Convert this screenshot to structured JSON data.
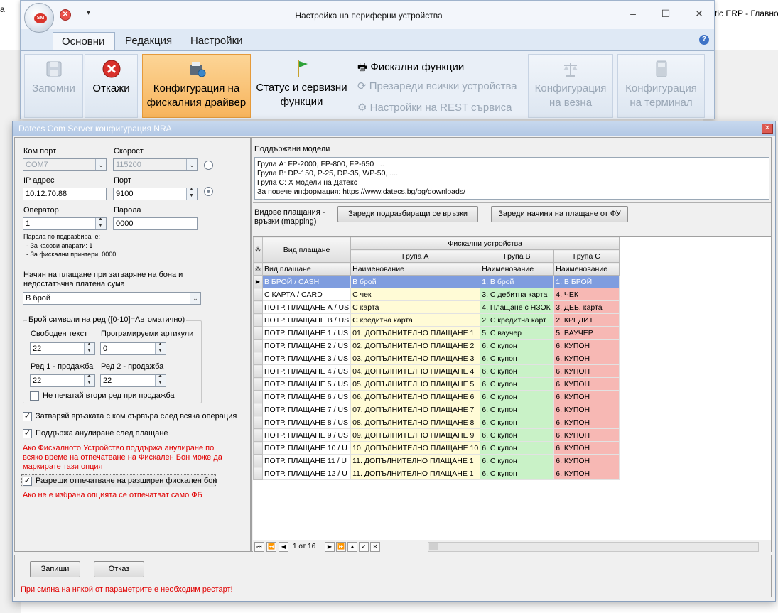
{
  "background_app": {
    "left_fragment": "a",
    "title_fragment": "tic ERP - Главно"
  },
  "outer_window": {
    "title": "Настройка на периферни устройства",
    "orb_text": "SM",
    "tabs": [
      {
        "label": "Основни",
        "active": true
      },
      {
        "label": "Редакция",
        "active": false
      },
      {
        "label": "Настройки",
        "active": false
      }
    ],
    "ribbon": {
      "save": "Запомни",
      "cancel": "Откажи",
      "fiscal_driver_line1": "Конфигурация на",
      "fiscal_driver_line2": "фискалния драйвер",
      "status_line1": "Статус и сервизни",
      "status_line2": "функции",
      "fiscal_functions": "Фискални функции",
      "reload_devices": "Презареди всички устройства",
      "rest_settings": "Настройки на REST сървиса",
      "scale_line1": "Конфигурация",
      "scale_line2": "на везна",
      "terminal_line1": "Конфигурация",
      "terminal_line2": "на терминал"
    }
  },
  "dialog": {
    "title": "Datecs Com Server конфигурация NRA",
    "left": {
      "com_port_label": "Ком порт",
      "com_port_value": "COM7",
      "speed_label": "Скорост",
      "speed_value": "115200",
      "ip_label": "IP адрес",
      "ip_value": "10.12.70.88",
      "port_label": "Порт",
      "port_value": "9100",
      "operator_label": "Оператор",
      "operator_value": "1",
      "password_label": "Парола",
      "password_value": "0000",
      "default_pw_title": "Парола по подразбиране:",
      "default_pw_cash": "- За касови апарати: 1",
      "default_pw_printers": "- За фискални принтери: 0000",
      "payment_close_label_1": "Начин на плащане при затваряне на бона и",
      "payment_close_label_2": "недостатъчна платена сума",
      "payment_close_value": "В брой",
      "symbols_group": "Брой символи на ред ([0-10]=Автоматично)",
      "free_text_label": "Свободен текст",
      "free_text_value": "22",
      "programmed_label": "Програмируеми артикули",
      "programmed_value": "0",
      "row1_label": "Ред 1 - продажба",
      "row1_value": "22",
      "row2_label": "Ред 2 - продажба",
      "row2_value": "22",
      "no_second_row": "Не печатай втори ред при продажба",
      "close_connection": "Затваряй връзката с ком сървъра след всяка операция",
      "support_void": "Поддържа анулиране след плащане",
      "void_note_1": "Ако Фискалното Устройство поддържа анулиране по",
      "void_note_2": "всяко време на отпечатване на Фискален Бон може да",
      "void_note_3": "маркирате тази опция",
      "extended_receipt": "Разреши отпечатване на разширен фискален бон",
      "extended_note": "Ако не е избрана опцията се отпечатват само ФБ"
    },
    "right": {
      "models_label": "Поддържани модели",
      "models_lines": [
        "Група А: FP-2000, FP-800, FP-650 ....",
        "Група B: DP-150, P-25, DP-35, WP-50, ....",
        "Група C: X модели на Датекс",
        "За повече информация: https://www.datecs.bg/bg/downloads/"
      ],
      "mapping_label_1": "Видове плащания -",
      "mapping_label_2": "връзки (mapping)",
      "load_default_btn": "Зареди подразбиращи се връзки",
      "load_fu_btn": "Зареди начини на плащане от ФУ",
      "grid": {
        "col_payment": "Вид плащане",
        "col_fiscal": "Фискални устройства",
        "col_group_a": "Група А",
        "col_group_b": "Група В",
        "col_group_c": "Група С",
        "sub_payment": "Вид плащане",
        "sub_name": "Наименование",
        "rows": [
          [
            "В БРОЙ / CASH",
            "В брой",
            "1. В брой",
            "1. В БРОЙ"
          ],
          [
            "С КАРТА / CARD",
            "С чек",
            "3. С дебитна карта",
            "4. ЧЕК"
          ],
          [
            "ПОТР. ПЛАЩАНЕ А / US",
            "С карта",
            "4. Плащане с НЗОК",
            "3. ДЕБ. карта"
          ],
          [
            "ПОТР. ПЛАЩАНЕ В / US",
            "С кредитна карта",
            "2. С кредитна карт",
            "2. КРЕДИТ"
          ],
          [
            "ПОТР. ПЛАЩАНЕ 1 / US",
            "01. ДОПЪЛНИТЕЛНО ПЛАЩАНЕ 1",
            "5. С ваучер",
            "5. ВАУЧЕР"
          ],
          [
            "ПОТР. ПЛАЩАНЕ 2 / US",
            "02. ДОПЪЛНИТЕЛНО ПЛАЩАНЕ 2",
            "6. С купон",
            "6. КУПОН"
          ],
          [
            "ПОТР. ПЛАЩАНЕ 3 / US",
            "03. ДОПЪЛНИТЕЛНО ПЛАЩАНЕ 3",
            "6. С купон",
            "6. КУПОН"
          ],
          [
            "ПОТР. ПЛАЩАНЕ 4 / US",
            "04. ДОПЪЛНИТЕЛНО ПЛАЩАНЕ 4",
            "6. С купон",
            "6. КУПОН"
          ],
          [
            "ПОТР. ПЛАЩАНЕ 5 / US",
            "05. ДОПЪЛНИТЕЛНО ПЛАЩАНЕ 5",
            "6. С купон",
            "6. КУПОН"
          ],
          [
            "ПОТР. ПЛАЩАНЕ 6 / US",
            "06. ДОПЪЛНИТЕЛНО ПЛАЩАНЕ 6",
            "6. С купон",
            "6. КУПОН"
          ],
          [
            "ПОТР. ПЛАЩАНЕ 7 / US",
            "07. ДОПЪЛНИТЕЛНО ПЛАЩАНЕ 7",
            "6. С купон",
            "6. КУПОН"
          ],
          [
            "ПОТР. ПЛАЩАНЕ 8 / US",
            "08. ДОПЪЛНИТЕЛНО ПЛАЩАНЕ 8",
            "6. С купон",
            "6. КУПОН"
          ],
          [
            "ПОТР. ПЛАЩАНЕ 9 / US",
            "09. ДОПЪЛНИТЕЛНО ПЛАЩАНЕ 9",
            "6. С купон",
            "6. КУПОН"
          ],
          [
            "ПОТР. ПЛАЩАНЕ 10 / U",
            "10. ДОПЪЛНИТЕЛНО ПЛАЩАНЕ 10",
            "6. С купон",
            "6. КУПОН"
          ],
          [
            "ПОТР. ПЛАЩАНЕ 11 / U",
            "11. ДОПЪЛНИТЕЛНО ПЛАЩАНЕ 1",
            "6. С купон",
            "6. КУПОН"
          ],
          [
            "ПОТР. ПЛАЩАНЕ 12 / U",
            "11. ДОПЪЛНИТЕЛНО ПЛАЩАНЕ 1",
            "6. С купон",
            "6. КУПОН"
          ]
        ],
        "pager_text": "1 от 16"
      }
    },
    "bottom": {
      "save_btn": "Запиши",
      "cancel_btn": "Отказ",
      "restart_note": "При смяна на някой от параметрите е необходим рестарт!"
    }
  }
}
